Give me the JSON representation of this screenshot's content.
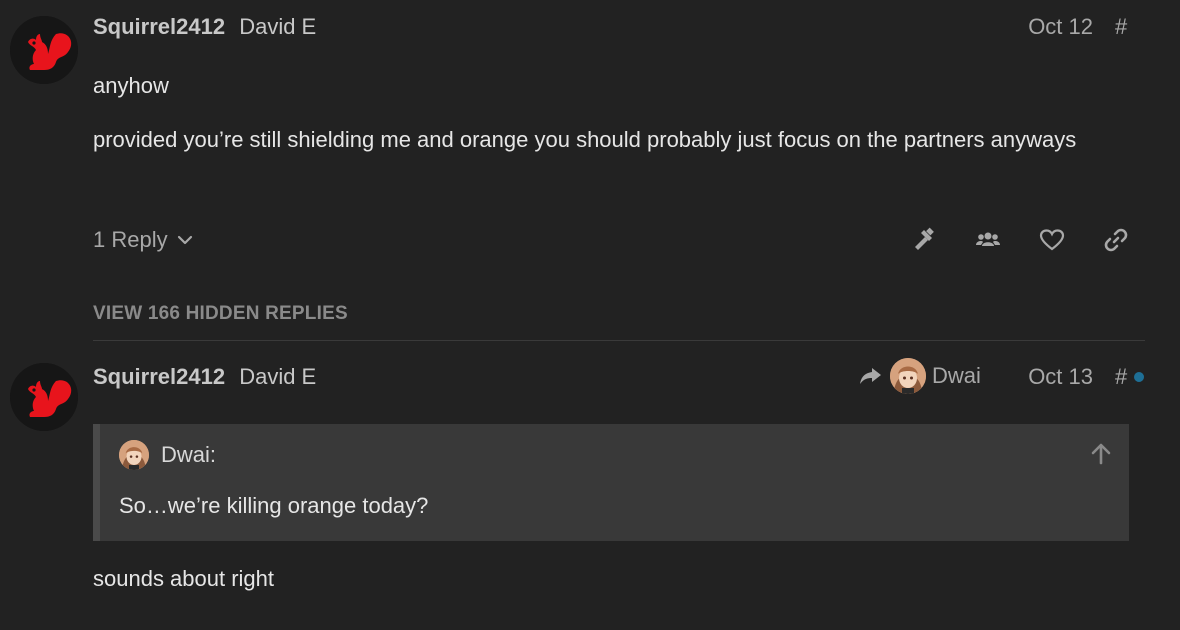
{
  "posts": [
    {
      "username": "Squirrel2412",
      "full_name": "David E",
      "date": "Oct 12",
      "hash": "#",
      "paragraphs": [
        "anyhow",
        "provided you’re still shielding me and orange you should probably just focus on the partners anyways"
      ],
      "replies_label": "1 Reply",
      "actions": [
        "hammer-icon",
        "group-icon",
        "heart-icon",
        "link-icon"
      ]
    },
    {
      "username": "Squirrel2412",
      "full_name": "David E",
      "reply_to": "Dwai",
      "date": "Oct 13",
      "hash": "#",
      "quote": {
        "author": "Dwai:",
        "text": "So…we’re killing orange today?"
      },
      "paragraphs": [
        "sounds about right"
      ]
    }
  ],
  "hidden_replies_label": "VIEW 166 HIDDEN REPLIES",
  "colors": {
    "background": "#222222",
    "squirrel_red": "#e8141c",
    "unread_dot": "#1e6f96"
  }
}
